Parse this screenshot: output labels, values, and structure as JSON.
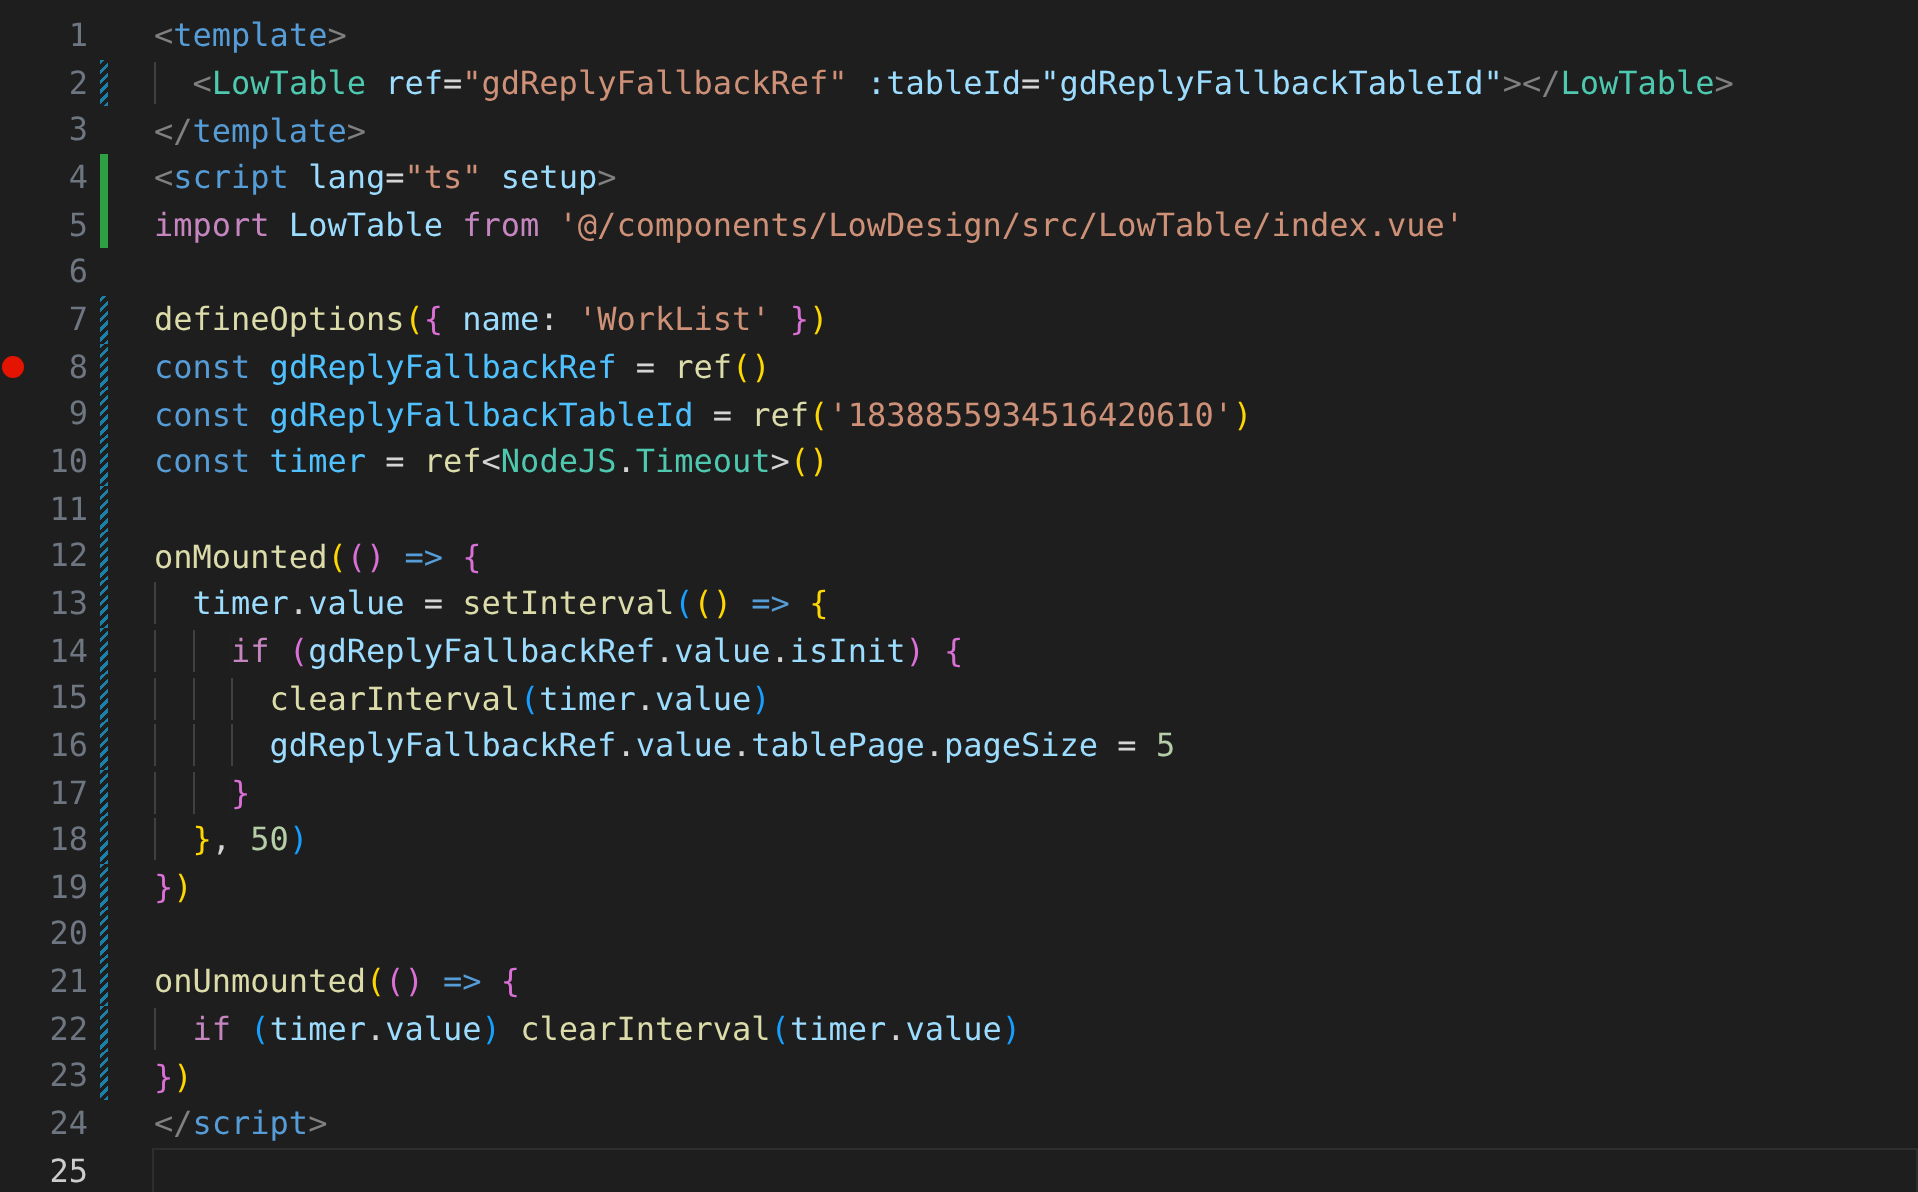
{
  "editor": {
    "lines": [
      {
        "number": "1",
        "modified": false,
        "added": false,
        "breakpoint": false,
        "current": false,
        "tokens": [
          {
            "text": "<",
            "color": "#808080"
          },
          {
            "text": "template",
            "color": "#569cd6"
          },
          {
            "text": ">",
            "color": "#808080"
          }
        ]
      },
      {
        "number": "2",
        "modified": true,
        "added": false,
        "breakpoint": false,
        "current": false,
        "tokens": [
          {
            "text": "  <",
            "color": "#808080"
          },
          {
            "text": "LowTable",
            "color": "#4ec9b0"
          },
          {
            "text": " ref",
            "color": "#9cdcfe"
          },
          {
            "text": "=",
            "color": "#d4d4d4"
          },
          {
            "text": "\"gdReplyFallbackRef\"",
            "color": "#ce9178"
          },
          {
            "text": " :tableId",
            "color": "#9cdcfe"
          },
          {
            "text": "=",
            "color": "#d4d4d4"
          },
          {
            "text": "\"gdReplyFallbackTableId\"",
            "color": "#9cdcfe"
          },
          {
            "text": "></",
            "color": "#808080"
          },
          {
            "text": "LowTable",
            "color": "#4ec9b0"
          },
          {
            "text": ">",
            "color": "#808080"
          }
        ]
      },
      {
        "number": "3",
        "modified": false,
        "added": false,
        "breakpoint": false,
        "current": false,
        "tokens": [
          {
            "text": "</",
            "color": "#808080"
          },
          {
            "text": "template",
            "color": "#569cd6"
          },
          {
            "text": ">",
            "color": "#808080"
          }
        ]
      },
      {
        "number": "4",
        "modified": false,
        "added": true,
        "breakpoint": false,
        "current": false,
        "tokens": [
          {
            "text": "<",
            "color": "#808080"
          },
          {
            "text": "script",
            "color": "#569cd6"
          },
          {
            "text": " lang",
            "color": "#9cdcfe"
          },
          {
            "text": "=",
            "color": "#d4d4d4"
          },
          {
            "text": "\"ts\"",
            "color": "#ce9178"
          },
          {
            "text": " setup",
            "color": "#9cdcfe"
          },
          {
            "text": ">",
            "color": "#808080"
          }
        ]
      },
      {
        "number": "5",
        "modified": false,
        "added": true,
        "breakpoint": false,
        "current": false,
        "tokens": [
          {
            "text": "import",
            "color": "#c586c0"
          },
          {
            "text": " LowTable ",
            "color": "#9cdcfe"
          },
          {
            "text": "from",
            "color": "#c586c0"
          },
          {
            "text": " '@/components/LowDesign/src/LowTable/index.vue'",
            "color": "#ce9178"
          }
        ]
      },
      {
        "number": "6",
        "modified": false,
        "added": false,
        "breakpoint": false,
        "current": false
      },
      {
        "number": "7",
        "modified": true,
        "added": false,
        "breakpoint": false,
        "current": false,
        "tokens": [
          {
            "text": "defineOptions",
            "color": "#dcdcaa"
          },
          {
            "text": "(",
            "color": "#ffd700"
          },
          {
            "text": "{",
            "color": "#da70d6"
          },
          {
            "text": " name",
            "color": "#9cdcfe"
          },
          {
            "text": ": ",
            "color": "#d4d4d4"
          },
          {
            "text": "'WorkList'",
            "color": "#ce9178"
          },
          {
            "text": " }",
            "color": "#da70d6"
          },
          {
            "text": ")",
            "color": "#ffd700"
          }
        ]
      },
      {
        "number": "8",
        "modified": true,
        "added": false,
        "breakpoint": true,
        "current": false,
        "tokens": [
          {
            "text": "const",
            "color": "#569cd6"
          },
          {
            "text": " gdReplyFallbackRef",
            "color": "#4fc1ff"
          },
          {
            "text": " = ",
            "color": "#d4d4d4"
          },
          {
            "text": "ref",
            "color": "#dcdcaa"
          },
          {
            "text": "()",
            "color": "#ffd700"
          }
        ]
      },
      {
        "number": "9",
        "modified": true,
        "added": false,
        "breakpoint": false,
        "current": false,
        "tokens": [
          {
            "text": "const",
            "color": "#569cd6"
          },
          {
            "text": " gdReplyFallbackTableId",
            "color": "#4fc1ff"
          },
          {
            "text": " = ",
            "color": "#d4d4d4"
          },
          {
            "text": "ref",
            "color": "#dcdcaa"
          },
          {
            "text": "(",
            "color": "#ffd700"
          },
          {
            "text": "'1838855934516420610'",
            "color": "#ce9178"
          },
          {
            "text": ")",
            "color": "#ffd700"
          }
        ]
      },
      {
        "number": "10",
        "modified": true,
        "added": false,
        "breakpoint": false,
        "current": false,
        "tokens": [
          {
            "text": "const",
            "color": "#569cd6"
          },
          {
            "text": " timer",
            "color": "#4fc1ff"
          },
          {
            "text": " = ",
            "color": "#d4d4d4"
          },
          {
            "text": "ref",
            "color": "#dcdcaa"
          },
          {
            "text": "<",
            "color": "#d4d4d4"
          },
          {
            "text": "NodeJS",
            "color": "#4ec9b0"
          },
          {
            "text": ".",
            "color": "#d4d4d4"
          },
          {
            "text": "Timeout",
            "color": "#4ec9b0"
          },
          {
            "text": ">",
            "color": "#d4d4d4"
          },
          {
            "text": "()",
            "color": "#ffd700"
          }
        ]
      },
      {
        "number": "11",
        "modified": true,
        "added": false,
        "breakpoint": false,
        "current": false
      },
      {
        "number": "12",
        "modified": true,
        "added": false,
        "breakpoint": false,
        "current": false,
        "tokens": [
          {
            "text": "onMounted",
            "color": "#dcdcaa"
          },
          {
            "text": "(",
            "color": "#ffd700"
          },
          {
            "text": "()",
            "color": "#da70d6"
          },
          {
            "text": " => ",
            "color": "#569cd6"
          },
          {
            "text": "{",
            "color": "#da70d6"
          }
        ]
      },
      {
        "number": "13",
        "modified": true,
        "added": false,
        "breakpoint": false,
        "current": false,
        "tokens": [
          {
            "text": "  timer",
            "color": "#9cdcfe"
          },
          {
            "text": ".",
            "color": "#d4d4d4"
          },
          {
            "text": "value",
            "color": "#9cdcfe"
          },
          {
            "text": " = ",
            "color": "#d4d4d4"
          },
          {
            "text": "setInterval",
            "color": "#dcdcaa"
          },
          {
            "text": "(",
            "color": "#179fff"
          },
          {
            "text": "()",
            "color": "#ffd700"
          },
          {
            "text": " => ",
            "color": "#569cd6"
          },
          {
            "text": "{",
            "color": "#ffd700"
          }
        ]
      },
      {
        "number": "14",
        "modified": true,
        "added": false,
        "breakpoint": false,
        "current": false,
        "tokens": [
          {
            "text": "    if ",
            "color": "#c586c0"
          },
          {
            "text": "(",
            "color": "#da70d6"
          },
          {
            "text": "gdReplyFallbackRef",
            "color": "#9cdcfe"
          },
          {
            "text": ".",
            "color": "#d4d4d4"
          },
          {
            "text": "value",
            "color": "#9cdcfe"
          },
          {
            "text": ".",
            "color": "#d4d4d4"
          },
          {
            "text": "isInit",
            "color": "#9cdcfe"
          },
          {
            "text": ")",
            "color": "#da70d6"
          },
          {
            "text": " {",
            "color": "#da70d6"
          }
        ]
      },
      {
        "number": "15",
        "modified": true,
        "added": false,
        "breakpoint": false,
        "current": false,
        "tokens": [
          {
            "text": "      clearInterval",
            "color": "#dcdcaa"
          },
          {
            "text": "(",
            "color": "#179fff"
          },
          {
            "text": "timer",
            "color": "#9cdcfe"
          },
          {
            "text": ".",
            "color": "#d4d4d4"
          },
          {
            "text": "value",
            "color": "#9cdcfe"
          },
          {
            "text": ")",
            "color": "#179fff"
          }
        ]
      },
      {
        "number": "16",
        "modified": true,
        "added": false,
        "breakpoint": false,
        "current": false,
        "tokens": [
          {
            "text": "      gdReplyFallbackRef",
            "color": "#9cdcfe"
          },
          {
            "text": ".",
            "color": "#d4d4d4"
          },
          {
            "text": "value",
            "color": "#9cdcfe"
          },
          {
            "text": ".",
            "color": "#d4d4d4"
          },
          {
            "text": "tablePage",
            "color": "#9cdcfe"
          },
          {
            "text": ".",
            "color": "#d4d4d4"
          },
          {
            "text": "pageSize",
            "color": "#9cdcfe"
          },
          {
            "text": " = ",
            "color": "#d4d4d4"
          },
          {
            "text": "5",
            "color": "#b5cea8"
          }
        ]
      },
      {
        "number": "17",
        "modified": true,
        "added": false,
        "breakpoint": false,
        "current": false,
        "tokens": [
          {
            "text": "    }",
            "color": "#da70d6"
          }
        ]
      },
      {
        "number": "18",
        "modified": true,
        "added": false,
        "breakpoint": false,
        "current": false,
        "tokens": [
          {
            "text": "  }",
            "color": "#ffd700"
          },
          {
            "text": ", ",
            "color": "#d4d4d4"
          },
          {
            "text": "50",
            "color": "#b5cea8"
          },
          {
            "text": ")",
            "color": "#179fff"
          }
        ]
      },
      {
        "number": "19",
        "modified": true,
        "added": false,
        "breakpoint": false,
        "current": false,
        "tokens": [
          {
            "text": "}",
            "color": "#da70d6"
          },
          {
            "text": ")",
            "color": "#ffd700"
          }
        ]
      },
      {
        "number": "20",
        "modified": true,
        "added": false,
        "breakpoint": false,
        "current": false
      },
      {
        "number": "21",
        "modified": true,
        "added": false,
        "breakpoint": false,
        "current": false,
        "tokens": [
          {
            "text": "onUnmounted",
            "color": "#dcdcaa"
          },
          {
            "text": "(",
            "color": "#ffd700"
          },
          {
            "text": "()",
            "color": "#da70d6"
          },
          {
            "text": " => ",
            "color": "#569cd6"
          },
          {
            "text": "{",
            "color": "#da70d6"
          }
        ]
      },
      {
        "number": "22",
        "modified": true,
        "added": false,
        "breakpoint": false,
        "current": false,
        "tokens": [
          {
            "text": "  if ",
            "color": "#c586c0"
          },
          {
            "text": "(",
            "color": "#179fff"
          },
          {
            "text": "timer",
            "color": "#9cdcfe"
          },
          {
            "text": ".",
            "color": "#d4d4d4"
          },
          {
            "text": "value",
            "color": "#9cdcfe"
          },
          {
            "text": ") ",
            "color": "#179fff"
          },
          {
            "text": "clearInterval",
            "color": "#dcdcaa"
          },
          {
            "text": "(",
            "color": "#179fff"
          },
          {
            "text": "timer",
            "color": "#9cdcfe"
          },
          {
            "text": ".",
            "color": "#d4d4d4"
          },
          {
            "text": "value",
            "color": "#9cdcfe"
          },
          {
            "text": ")",
            "color": "#179fff"
          }
        ]
      },
      {
        "number": "23",
        "modified": true,
        "added": false,
        "breakpoint": false,
        "current": false,
        "tokens": [
          {
            "text": "}",
            "color": "#da70d6"
          },
          {
            "text": ")",
            "color": "#ffd700"
          }
        ]
      },
      {
        "number": "24",
        "modified": false,
        "added": false,
        "breakpoint": false,
        "current": false,
        "tokens": [
          {
            "text": "</",
            "color": "#808080"
          },
          {
            "text": "script",
            "color": "#569cd6"
          },
          {
            "text": ">",
            "color": "#808080"
          }
        ]
      },
      {
        "number": "25",
        "modified": false,
        "added": false,
        "breakpoint": false,
        "current": true
      }
    ]
  }
}
